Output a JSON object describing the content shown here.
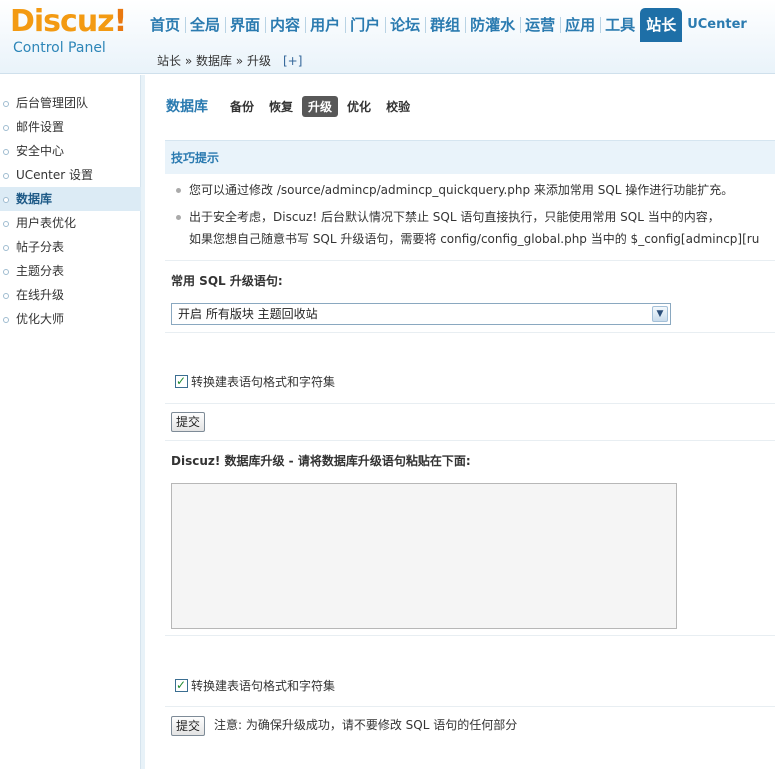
{
  "logo": {
    "brand": "Discuz",
    "bang": "!",
    "subtitle": "Control Panel"
  },
  "topnav": [
    {
      "label": "首页"
    },
    {
      "label": "全局"
    },
    {
      "label": "界面"
    },
    {
      "label": "内容"
    },
    {
      "label": "用户"
    },
    {
      "label": "门户"
    },
    {
      "label": "论坛"
    },
    {
      "label": "群组"
    },
    {
      "label": "防灌水"
    },
    {
      "label": "运营"
    },
    {
      "label": "应用"
    },
    {
      "label": "工具"
    },
    {
      "label": "站长",
      "active": true
    },
    {
      "label": "UCenter"
    }
  ],
  "breadcrumb": {
    "text": "站长 » 数据库 » 升级",
    "plus": "[+]"
  },
  "sidebar": [
    {
      "label": "后台管理团队"
    },
    {
      "label": "邮件设置"
    },
    {
      "label": "安全中心"
    },
    {
      "label": "UCenter 设置"
    },
    {
      "label": "数据库",
      "active": true
    },
    {
      "label": "用户表优化"
    },
    {
      "label": "帖子分表"
    },
    {
      "label": "主题分表"
    },
    {
      "label": "在线升级"
    },
    {
      "label": "优化大师"
    }
  ],
  "subnav": {
    "title": "数据库",
    "tabs": [
      {
        "label": "备份"
      },
      {
        "label": "恢复"
      },
      {
        "label": "升级",
        "active": true
      },
      {
        "label": "优化"
      },
      {
        "label": "校验"
      }
    ]
  },
  "tips": {
    "heading": "技巧提示",
    "item1": "您可以通过修改 /source/admincp/admincp_quickquery.php 来添加常用 SQL 操作进行功能扩充。",
    "item2_line1": "出于安全考虑，Discuz! 后台默认情况下禁止 SQL 语句直接执行，只能使用常用 SQL 当中的内容，",
    "item2_line2": "如果您想自己随意书写 SQL 升级语句，需要将 config/config_global.php 当中的 $_config[admincp][ru"
  },
  "quick_sql": {
    "label": "常用 SQL 升级语句:",
    "selected": "开启 所有版块 主题回收站",
    "checkbox_label": "转换建表语句格式和字符集",
    "submit": "提交"
  },
  "upgrade": {
    "label": "Discuz! 数据库升级 - 请将数据库升级语句粘贴在下面:",
    "textarea_value": "",
    "checkbox_label": "转换建表语句格式和字符集",
    "submit": "提交",
    "note": "注意: 为确保升级成功，请不要修改 SQL 语句的任何部分"
  },
  "colors": {
    "brand_orange": "#f39a12",
    "nav_blue": "#2b7bb0",
    "active_tab_bg": "#1e6fa7"
  }
}
